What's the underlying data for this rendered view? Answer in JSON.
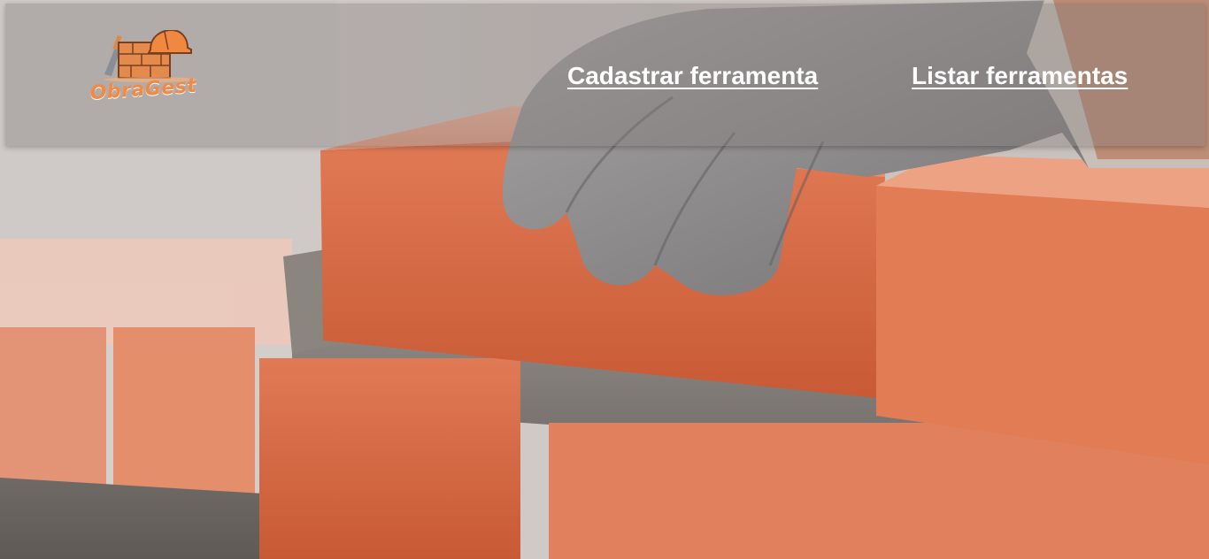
{
  "app": {
    "logo_text": "ObraGest",
    "logo_icon": "brick-wall-hardhat-trowel-icon"
  },
  "nav": {
    "items": [
      {
        "label": "Cadastrar ferramenta"
      },
      {
        "label": "Listar ferramentas"
      }
    ]
  },
  "colors": {
    "brand_orange": "#f08a45",
    "nav_text": "#ffffff",
    "navbar_overlay": "rgba(130,120,120,0.38)"
  }
}
